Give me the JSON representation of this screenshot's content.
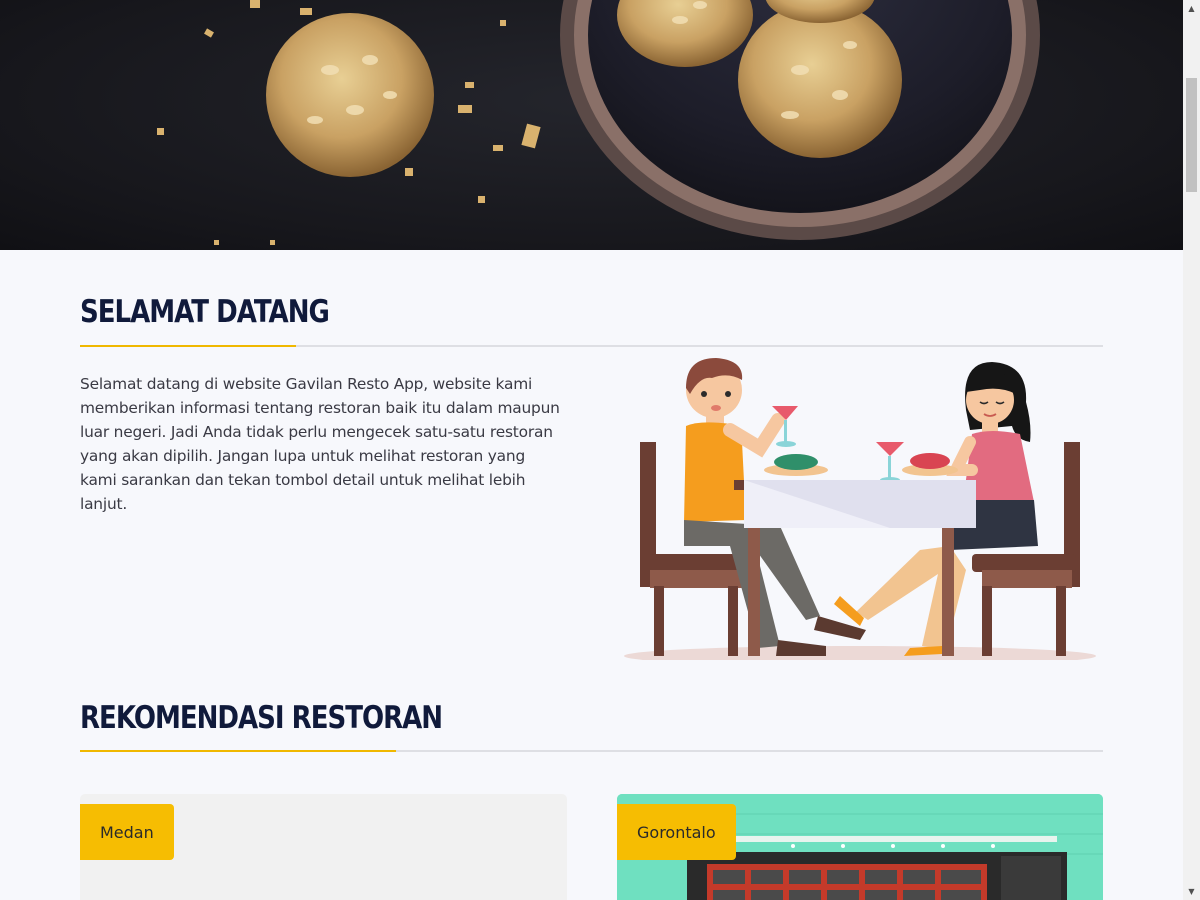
{
  "welcome": {
    "title": "SELAMAT DATANG",
    "text": "Selamat datang di website Gavilan Resto App, website kami memberikan informasi tentang restoran baik itu dalam maupun luar negeri. Jadi Anda tidak perlu mengecek satu-satu restoran yang akan dipilih. Jangan lupa untuk melihat restoran yang kami sarankan dan tekan tombol detail untuk melihat lebih lanjut."
  },
  "recommendations": {
    "title": "REKOMENDASI RESTORAN",
    "restaurants": [
      {
        "city": "Medan"
      },
      {
        "city": "Gorontalo"
      }
    ]
  },
  "colors": {
    "accent": "#f6bd02",
    "title": "#101a3b",
    "background": "#f7f8fc"
  },
  "icons": {
    "scroll_up": "triangle-up-icon",
    "scroll_down": "triangle-down-icon"
  }
}
